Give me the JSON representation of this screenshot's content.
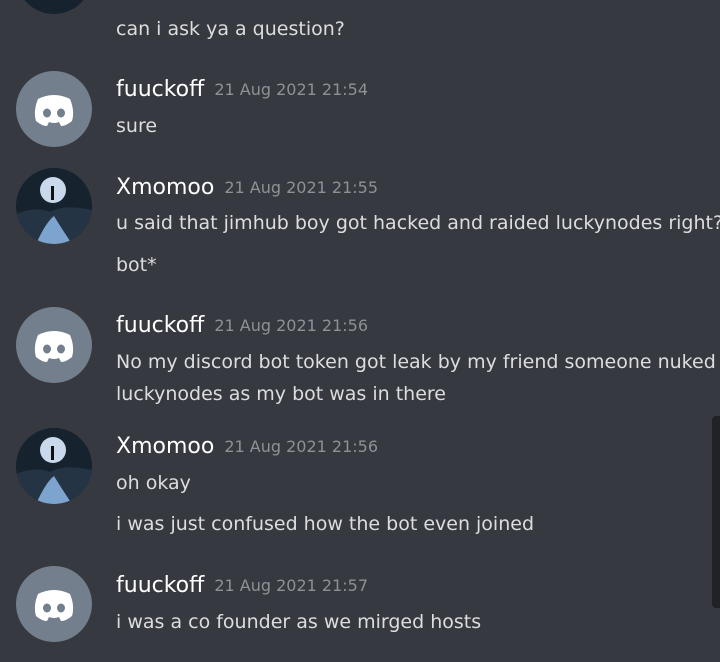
{
  "messages": [
    {
      "username": "",
      "timestamp": "",
      "avatar_icon": "moon-figure-avatar",
      "lines": [
        "can i ask ya a question?"
      ]
    },
    {
      "username": "fuuckoff",
      "timestamp": "21 Aug 2021 21:54",
      "avatar_icon": "discord-default-avatar",
      "lines": [
        "sure"
      ]
    },
    {
      "username": "Xmomoo",
      "timestamp": "21 Aug 2021 21:55",
      "avatar_icon": "moon-figure-avatar",
      "lines": [
        "u said that jimhub boy got hacked and raided luckynodes right?",
        "bot*"
      ]
    },
    {
      "username": "fuuckoff",
      "timestamp": "21 Aug 2021 21:56",
      "avatar_icon": "discord-default-avatar",
      "lines": [
        "No my discord bot token got leak by my friend someone nuked",
        "luckynodes as my bot was in there"
      ]
    },
    {
      "username": "Xmomoo",
      "timestamp": "21 Aug 2021 21:56",
      "avatar_icon": "moon-figure-avatar",
      "lines": [
        "oh okay",
        "i was just confused how the bot even joined"
      ]
    },
    {
      "username": "fuuckoff",
      "timestamp": "21 Aug 2021 21:57",
      "avatar_icon": "discord-default-avatar",
      "lines": [
        "i was a co founder as we mirged hosts"
      ]
    }
  ],
  "colors": {
    "background": "#36393f",
    "username": "#ffffff",
    "timestamp": "#8e9297",
    "message_text": "#dcddde",
    "discord_avatar_bg": "#747f8d"
  }
}
